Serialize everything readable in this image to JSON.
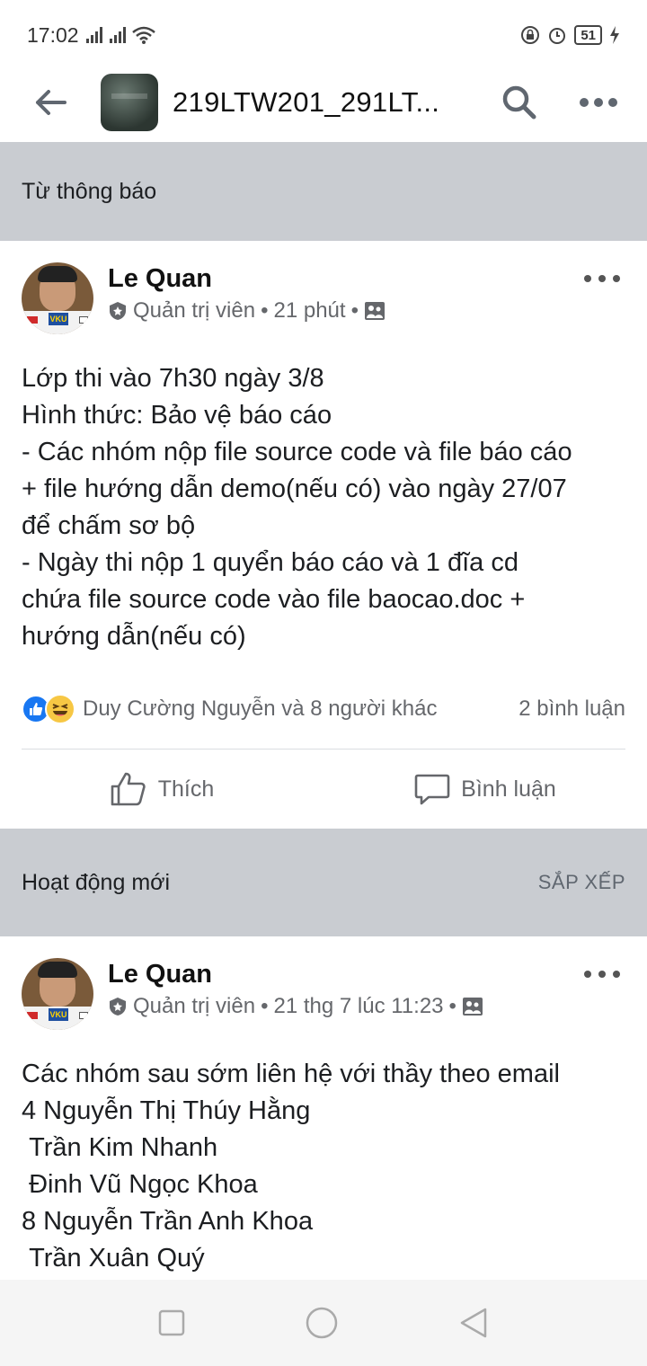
{
  "status_bar": {
    "time": "17:02",
    "battery": "51"
  },
  "app_bar": {
    "title": "219LTW201_291LT..."
  },
  "pinned_section": {
    "title": "Từ thông báo"
  },
  "pinned_post": {
    "author": "Le Quan",
    "role": "Quản trị viên",
    "time": "21 phút",
    "body": "Lớp thi vào 7h30 ngày 3/8\nHình thức: Bảo vệ báo cáo\n- Các nhóm nộp file source code và file báo cáo\n+ file hướng dẫn demo(nếu có) vào ngày 27/07\nđể chấm sơ bộ\n- Ngày thi nộp 1 quyển báo cáo và 1 đĩa cd\nchứa file source code vào file baocao.doc +\nhướng dẫn(nếu có)",
    "reactions_text": "Duy Cường Nguyễn và 8 người khác",
    "comments_count": "2 bình luận",
    "like_label": "Thích",
    "comment_label": "Bình luận"
  },
  "activity_section": {
    "title": "Hoạt động mới",
    "sort_label": "SẮP XẾP"
  },
  "recent_post": {
    "author": "Le Quan",
    "role": "Quản trị viên",
    "time": "21 thg 7 lúc 11:23",
    "body": "Các nhóm sau sớm liên hệ với thầy theo email\n4 Nguyễn Thị Thúy Hằng\n Trần Kim Nhanh\n Đinh Vũ Ngọc Khoa\n8 Nguyễn Trần Anh Khoa\n Trần Xuân Quý"
  },
  "avatar_badge": "VKU",
  "icons": {
    "back": "back-arrow-icon",
    "search": "search-icon",
    "more": "more-horizontal-icon",
    "shield": "admin-shield-icon",
    "audience": "group-audience-icon",
    "like": "thumbs-up-icon",
    "haha": "haha-reaction-icon",
    "comment": "comment-bubble-icon"
  },
  "colors": {
    "accent": "#1877f2",
    "section_bg": "#c9ccd1",
    "meta_text": "#65676b"
  }
}
